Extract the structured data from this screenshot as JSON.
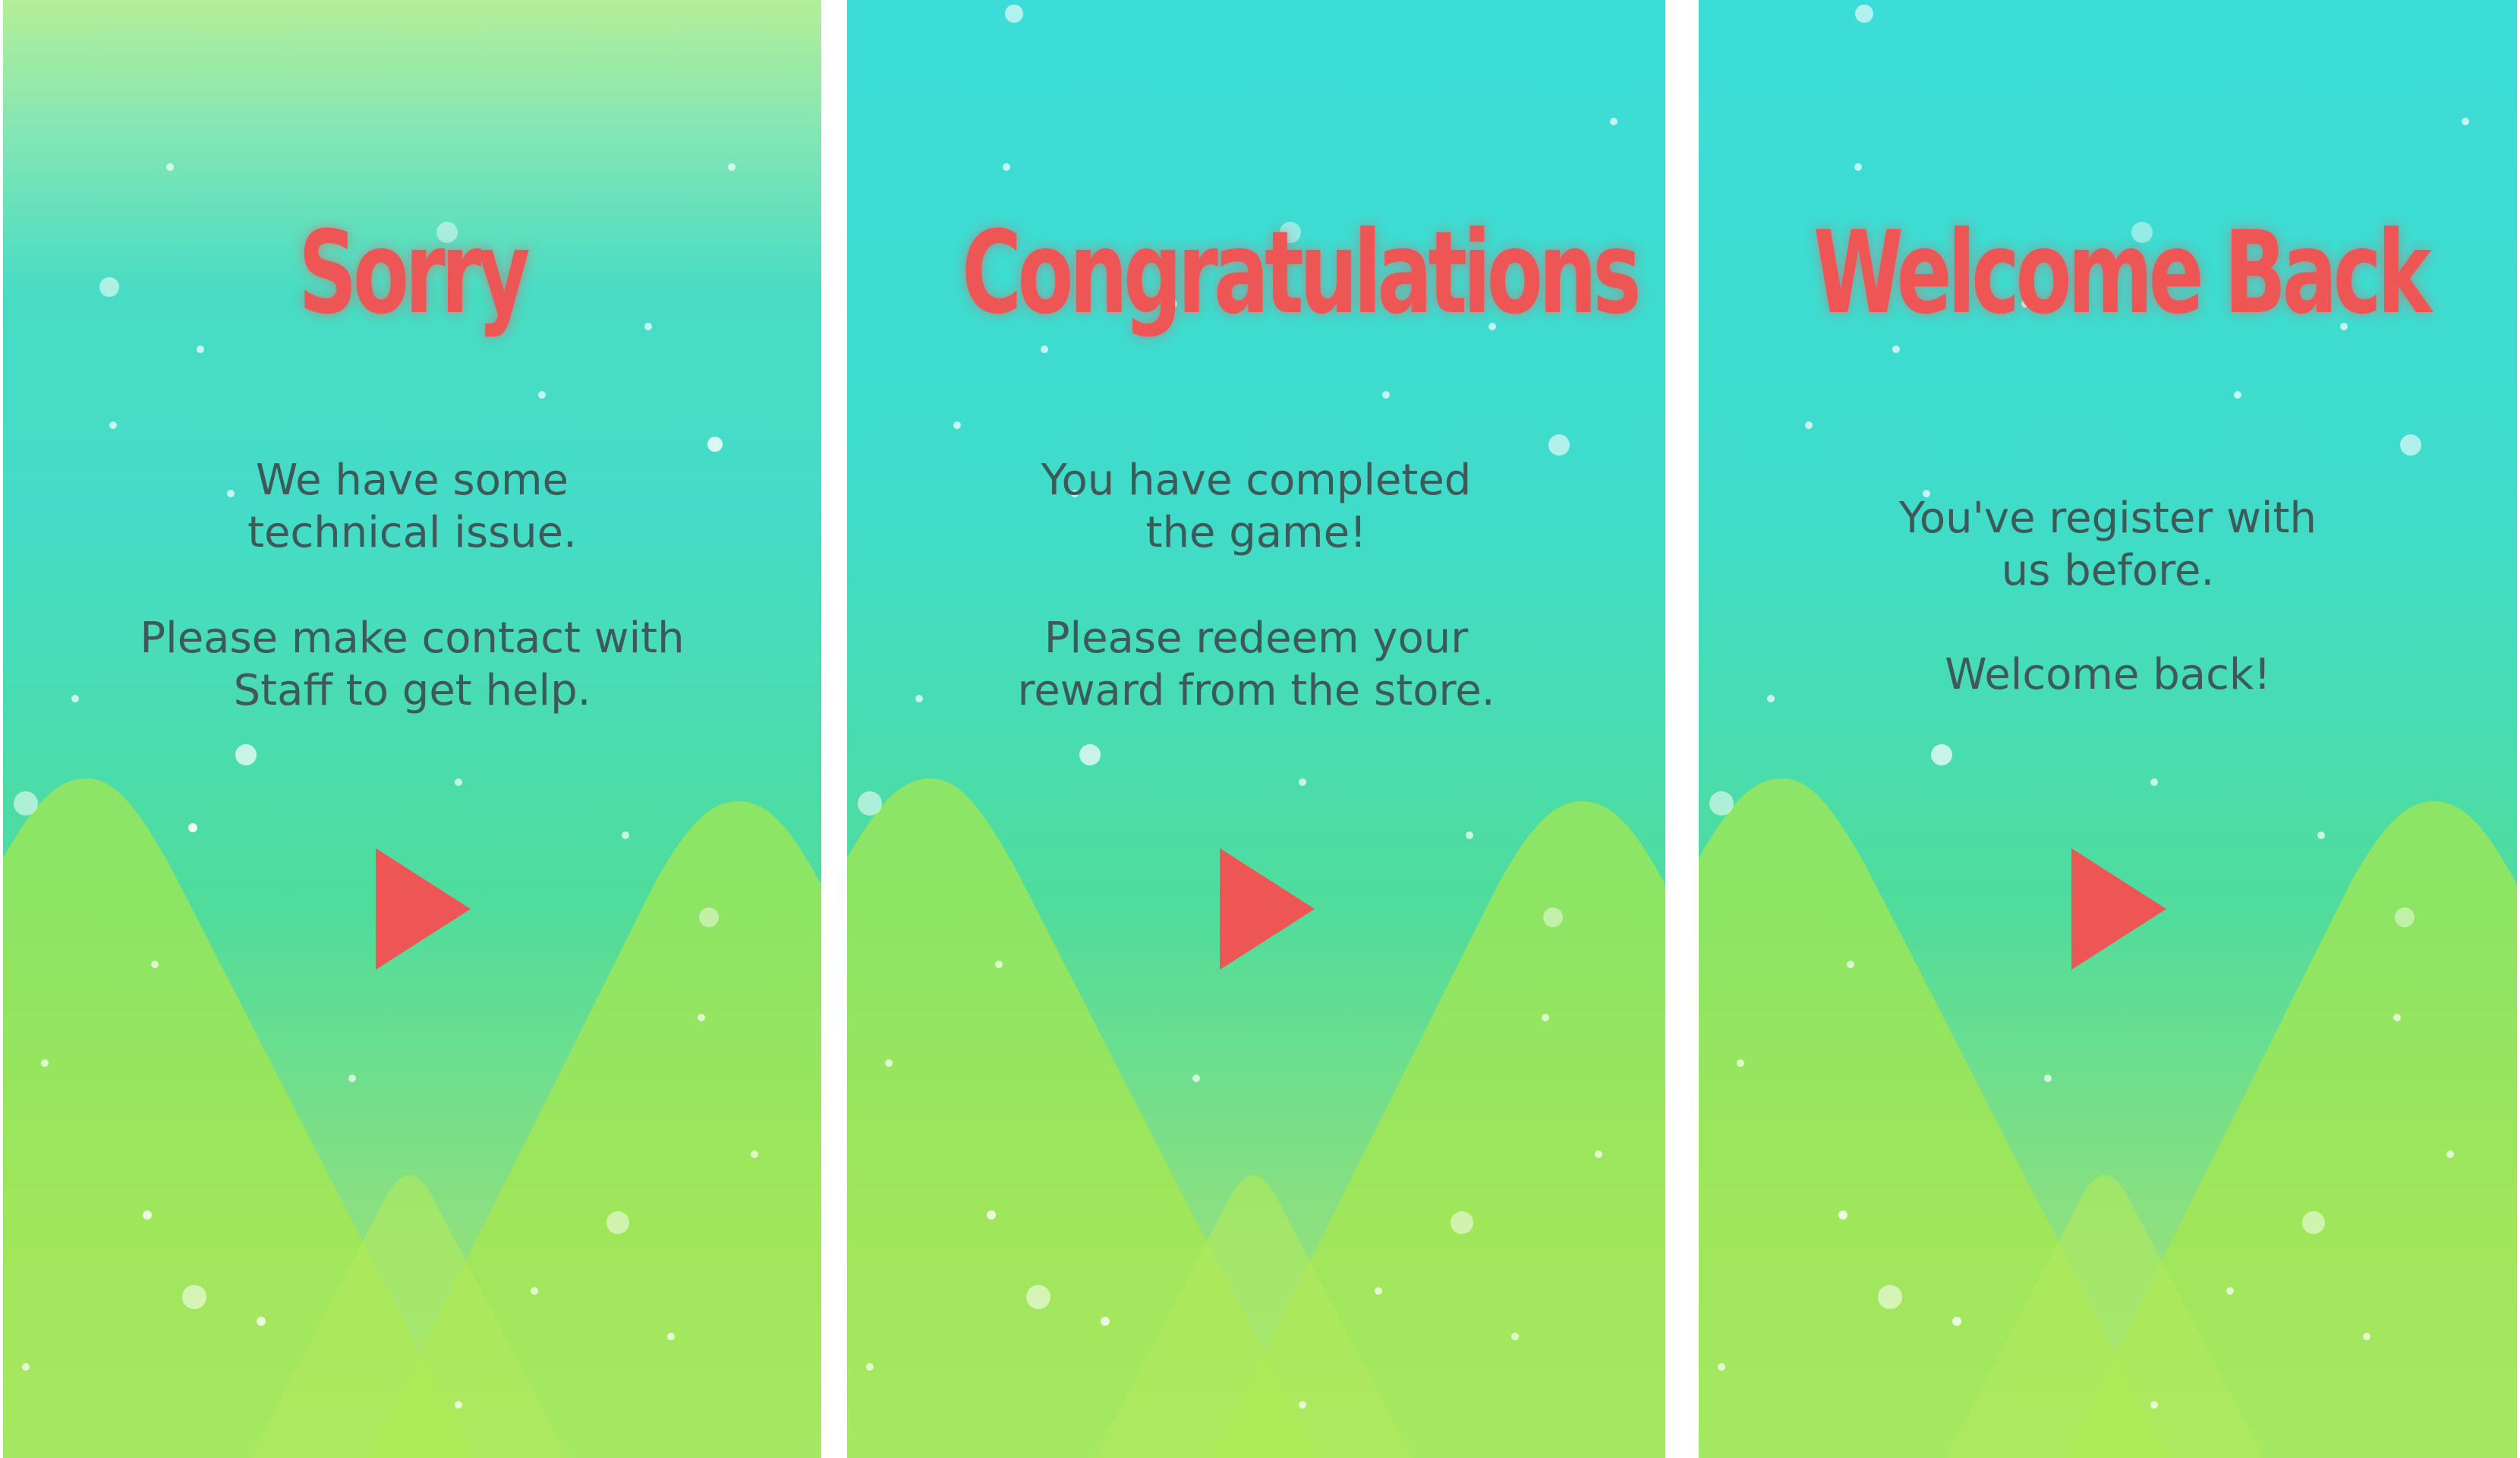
{
  "colors": {
    "title": "#ee5555",
    "body_text": "#3e5a58",
    "play_button": "#ee5555",
    "sky_top": "#3cdcd8",
    "sky_bottom": "#9fe89a",
    "hills": "#a8e84c"
  },
  "screens": [
    {
      "title": "Sorry",
      "message_block_1": [
        "We have some",
        "technical issue."
      ],
      "message_block_2": [
        "Please make contact with",
        "Staff to get help."
      ],
      "play_icon": "play-triangle-icon"
    },
    {
      "title": "Congratulations",
      "message_block_1": [
        "You have completed",
        "the game!"
      ],
      "message_block_2": [
        "Please redeem your",
        "reward from the store."
      ],
      "play_icon": "play-triangle-icon"
    },
    {
      "title": "Welcome Back",
      "message_block_1": [
        "You've register with",
        "us before."
      ],
      "message_block_2": [
        "Welcome back!"
      ],
      "play_icon": "play-triangle-icon"
    }
  ]
}
